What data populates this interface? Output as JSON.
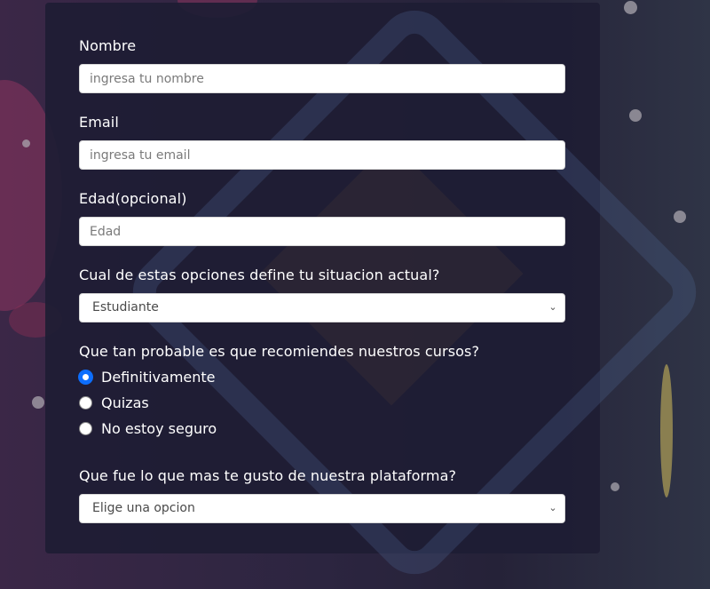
{
  "form": {
    "name": {
      "label": "Nombre",
      "placeholder": "ingresa tu nombre"
    },
    "email": {
      "label": "Email",
      "placeholder": "ingresa tu email"
    },
    "age": {
      "label": "Edad(opcional)",
      "placeholder": "Edad"
    },
    "situation": {
      "label": "Cual de estas opciones define tu situacion actual?",
      "selected": "Estudiante"
    },
    "recommend": {
      "label": "Que tan probable es que recomiendes nuestros cursos?",
      "options": [
        "Definitivamente",
        "Quizas",
        "No estoy seguro"
      ],
      "selected_index": 0
    },
    "liked": {
      "label": "Que fue lo que mas te gusto de nuestra plataforma?",
      "selected": "Elige una opcion"
    }
  },
  "colors": {
    "accent": "#0d6efd",
    "card": "#1e1d34"
  },
  "icons": {
    "select_arrow": "chevron-down-icon"
  }
}
